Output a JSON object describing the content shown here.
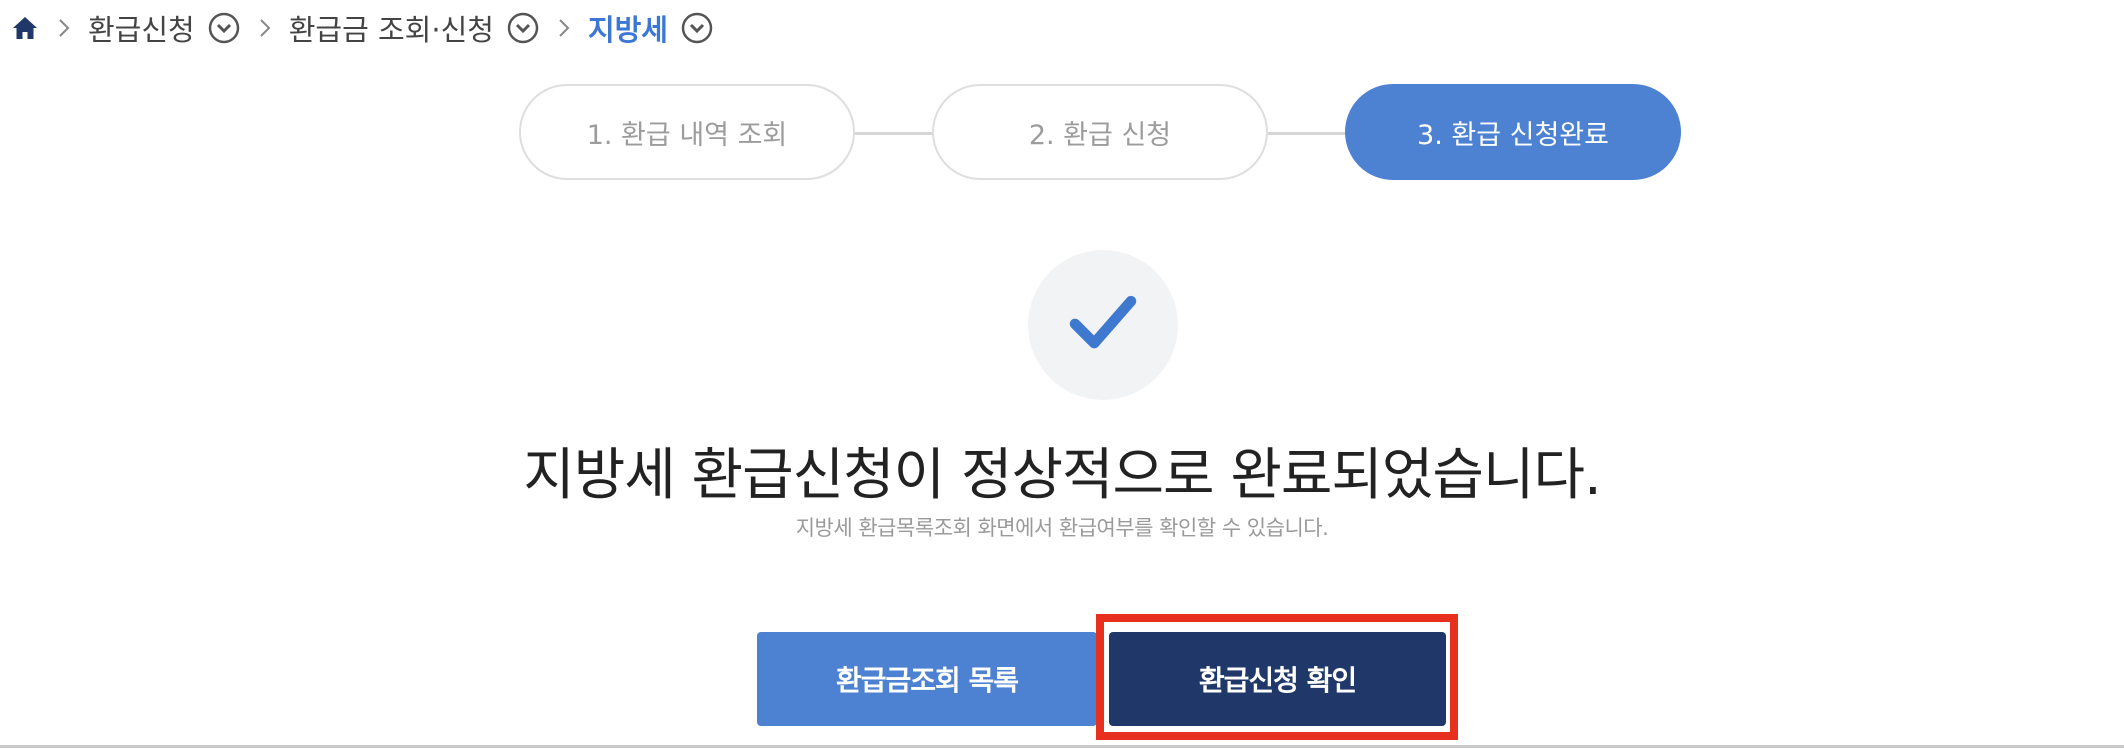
{
  "breadcrumb": {
    "items": [
      {
        "label": "환급신청"
      },
      {
        "label": "환급금 조회·신청"
      },
      {
        "label": "지방세"
      }
    ]
  },
  "steps": [
    {
      "label": "1. 환급 내역 조회",
      "active": false
    },
    {
      "label": "2. 환급 신청",
      "active": false
    },
    {
      "label": "3. 환급 신청완료",
      "active": true
    }
  ],
  "completion": {
    "message": "지방세 환급신청이 정상적으로 완료되었습니다.",
    "sub_message": "지방세 환급목록조회 화면에서 환급여부를 확인할 수 있습니다."
  },
  "buttons": {
    "list_label": "환급금조회 목록",
    "confirm_label": "환급신청 확인"
  },
  "colors": {
    "accent": "#4c82d1",
    "dark": "#1f3869",
    "highlight": "#e8301e"
  }
}
